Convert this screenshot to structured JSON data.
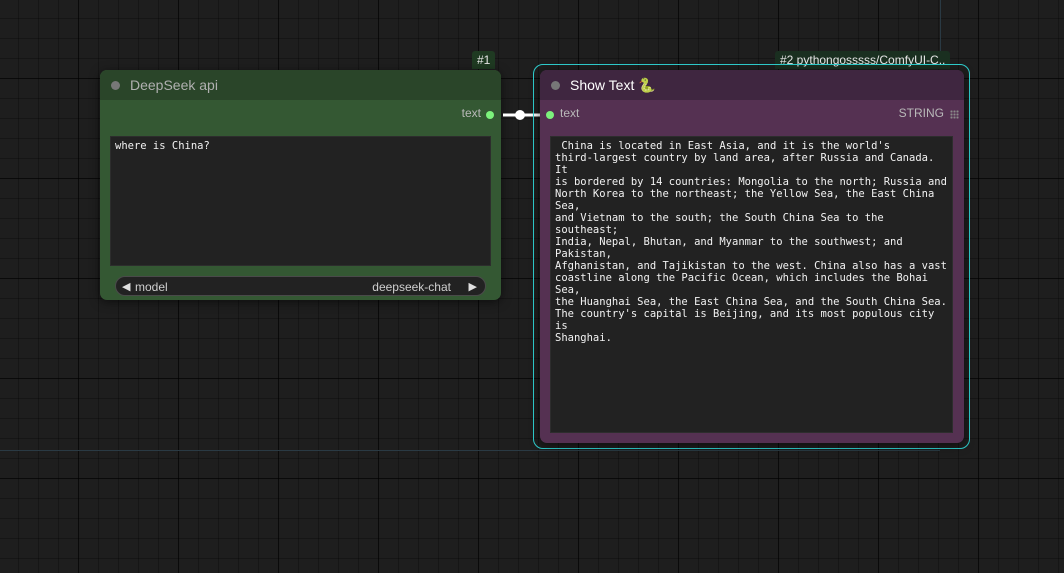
{
  "node1": {
    "id_badge": "#1",
    "title": "DeepSeek api",
    "output_label": "text",
    "prompt_text": "where is China?",
    "model_widget": {
      "label": "model",
      "value": "deepseek-chat"
    },
    "colors": {
      "body": "#345833",
      "title_bar": "#2a4529"
    }
  },
  "node2": {
    "id_badge": "#2 pythongosssss/ComfyUI-C..",
    "title": "Show Text 🐍",
    "input_label": "text",
    "output_type": "STRING",
    "text_output": " China is located in East Asia, and it is the world's\nthird-largest country by land area, after Russia and Canada. It\nis bordered by 14 countries: Mongolia to the north; Russia and\nNorth Korea to the northeast; the Yellow Sea, the East China Sea,\nand Vietnam to the south; the South China Sea to the southeast;\nIndia, Nepal, Bhutan, and Myanmar to the southwest; and Pakistan,\nAfghanistan, and Tajikistan to the west. China also has a vast\ncoastline along the Pacific Ocean, which includes the Bohai Sea,\nthe Huanghai Sea, the East China Sea, and the South China Sea.\nThe country's capital is Beijing, and its most populous city is\nShanghai.",
    "colors": {
      "body": "#553152",
      "title_bar": "#3f2640",
      "selection_outline": "#2fd0d0"
    }
  },
  "link_color": "#ffffff",
  "slot_color": "#7cf27c"
}
